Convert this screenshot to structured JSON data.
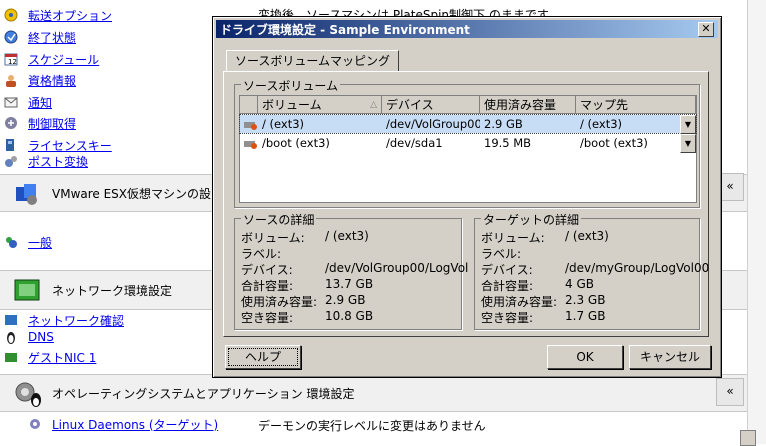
{
  "background": {
    "nav_items": [
      {
        "label": "転送オプション",
        "icon": "transfer-icon"
      },
      {
        "label": "終了状態",
        "icon": "end-state-icon"
      },
      {
        "label": "スケジュール",
        "icon": "schedule-icon"
      },
      {
        "label": "資格情報",
        "icon": "credentials-icon"
      },
      {
        "label": "通知",
        "icon": "mail-icon"
      },
      {
        "label": "制御取得",
        "icon": "control-icon"
      },
      {
        "label": "ライセンスキー",
        "icon": "key-icon"
      },
      {
        "label": "ポスト変換",
        "icon": "post-convert-icon"
      }
    ],
    "top_value_text": "変換後、ソースマシンは PlateSpin制御下 のままです",
    "section_vmware": "VMware ESX仮想マシンの設",
    "item_general": "一般",
    "section_network": "ネットワーク環境設定",
    "network_items": [
      {
        "label": "ネットワーク確認",
        "icon": "network-check-icon"
      },
      {
        "label": "DNS",
        "icon": "dns-icon"
      },
      {
        "label": "ゲストNIC 1",
        "icon": "nic-icon"
      }
    ],
    "section_os": "オペレーティングシステムとアプリケーション 環境設定",
    "linux_daemons_label": "Linux Daemons (ターゲット)",
    "linux_daemons_value": "デーモンの実行レベルに変更はありません",
    "chevron": "«"
  },
  "dialog": {
    "title": "ドライブ環境設定 - Sample Environment",
    "close": "✕",
    "tab": "ソースボリュームマッピング",
    "source_volumes_group": "ソースボリューム",
    "columns": [
      "ボリューム",
      "デバイス",
      "使用済み容量",
      "マップ先"
    ],
    "rows": [
      {
        "volume": "/ (ext3)",
        "device": "/dev/VolGroup00...",
        "used": "2.9 GB",
        "map_to": "/ (ext3)"
      },
      {
        "volume": "/boot (ext3)",
        "device": "/dev/sda1",
        "used": "19.5 MB",
        "map_to": "/boot (ext3)"
      }
    ],
    "source_details": {
      "title": "ソースの詳細",
      "rows": [
        {
          "k": "ボリューム:",
          "v": "/ (ext3)"
        },
        {
          "k": "ラベル:",
          "v": ""
        },
        {
          "k": "デバイス:",
          "v": "/dev/VolGroup00/LogVol"
        },
        {
          "k": "合計容量:",
          "v": "13.7 GB"
        },
        {
          "k": "使用済み容量:",
          "v": "2.9 GB"
        },
        {
          "k": "空き容量:",
          "v": "10.8 GB"
        }
      ]
    },
    "target_details": {
      "title": "ターゲットの詳細",
      "rows": [
        {
          "k": "ボリューム:",
          "v": "/ (ext3)"
        },
        {
          "k": "ラベル:",
          "v": ""
        },
        {
          "k": "デバイス:",
          "v": "/dev/myGroup/LogVol00"
        },
        {
          "k": "合計容量:",
          "v": "4 GB"
        },
        {
          "k": "使用済み容量:",
          "v": "2.3 GB"
        },
        {
          "k": "空き容量:",
          "v": "1.7 GB"
        }
      ]
    },
    "help_button": "ヘルプ",
    "ok_button": "OK",
    "cancel_button": "キャンセル",
    "title_bar_color": "#0a246a",
    "selected_row_color": "#c7dcf5"
  }
}
